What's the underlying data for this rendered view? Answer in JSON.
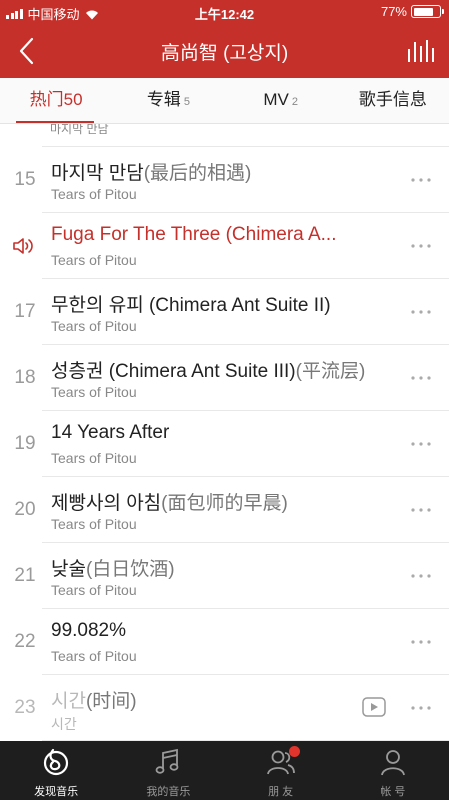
{
  "status_bar": {
    "carrier": "中国移动",
    "time": "上午12:42",
    "battery": "77%",
    "battery_level": 0.77
  },
  "header": {
    "title": "高尚智 (고상지)",
    "back_icon": "chevron-left-icon",
    "now_playing_icon": "bars-icon"
  },
  "tabs": [
    {
      "label": "热门50",
      "count": ""
    },
    {
      "label": "专辑",
      "count": "5"
    },
    {
      "label": "MV",
      "count": "2"
    },
    {
      "label": "歌手信息",
      "count": ""
    }
  ],
  "list": {
    "partial_artist": "마지막 만남",
    "songs": [
      {
        "index": "15",
        "title": "마지막 만담",
        "alias": "(最后的相遇)",
        "artist": "Tears of Pitou"
      },
      {
        "index": "",
        "title": "Fuga For The Three (Chimera A...",
        "alias": "",
        "artist": "Tears of Pitou",
        "playing": true
      },
      {
        "index": "17",
        "title": "무한의 유피 (Chimera Ant Suite II)",
        "alias": "",
        "artist": "Tears of Pitou"
      },
      {
        "index": "18",
        "title": "성층권 (Chimera Ant Suite III)",
        "alias": "(平流层)",
        "artist": "Tears of Pitou"
      },
      {
        "index": "19",
        "title": "14 Years After",
        "alias": "",
        "artist": "Tears of Pitou"
      },
      {
        "index": "20",
        "title": "제빵사의 아침",
        "alias": "(面包师的早晨)",
        "artist": "Tears of Pitou"
      },
      {
        "index": "21",
        "title": "낮술",
        "alias": "(白日饮酒)",
        "artist": "Tears of Pitou"
      },
      {
        "index": "22",
        "title": "99.082%",
        "alias": "",
        "artist": "Tears of Pitou"
      },
      {
        "index": "23",
        "title": "시간",
        "alias": "(时间)",
        "artist": "시간",
        "disabled": true,
        "mv": true
      }
    ]
  },
  "bottom_nav": [
    {
      "label": "发现音乐",
      "icon": "netease-logo-icon"
    },
    {
      "label": "我的音乐",
      "icon": "music-note-icon"
    },
    {
      "label": "朋 友",
      "icon": "friends-icon"
    },
    {
      "label": "帐 号",
      "icon": "user-icon"
    }
  ],
  "colors": {
    "brand": "#c6302b",
    "bottom_bar": "#1e1e1f",
    "badge": "#e0342c"
  }
}
